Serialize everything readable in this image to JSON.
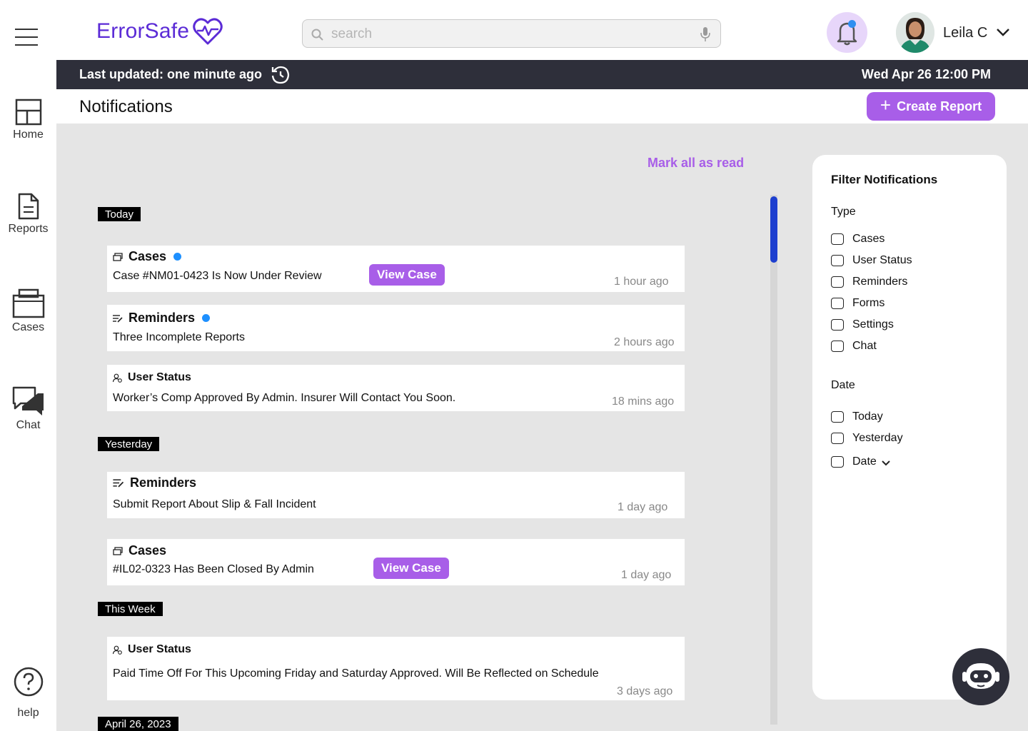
{
  "brand": {
    "name": "ErrorSafe",
    "accent": "#a85ee8",
    "logo_color": "#5b2bd6"
  },
  "rail": {
    "items": [
      {
        "label": "Home",
        "icon": "home-layout-icon"
      },
      {
        "label": "Reports",
        "icon": "document-icon"
      },
      {
        "label": "Cases",
        "icon": "briefcase-icon"
      },
      {
        "label": "Chat",
        "icon": "chat-bubbles-icon"
      }
    ],
    "help_label": "help"
  },
  "header": {
    "search_placeholder": "search",
    "user_name": "Leila C",
    "notification_unread": true
  },
  "statusbar": {
    "updated": "Last updated: one minute ago",
    "datetime": "Wed Apr 26 12:00 PM"
  },
  "page": {
    "title": "Notifications",
    "create_label": "Create Report",
    "mark_all_read": "Mark all as read"
  },
  "sections": {
    "today": "Today",
    "yesterday": "Yesterday",
    "this_week": "This Week",
    "april": "April 26, 2023"
  },
  "notifications": [
    {
      "type": "Cases",
      "icon": "cases-icon",
      "message": "Case #NM01-0423 Is Now Under Review",
      "time": "1 hour ago",
      "unread": true,
      "action": "View Case"
    },
    {
      "type": "Reminders",
      "icon": "reminder-icon",
      "message": "Three Incomplete Reports",
      "time": "2 hours ago",
      "unread": true
    },
    {
      "type": "User Status",
      "icon": "user-status-icon",
      "message": "Worker’s Comp Approved By Admin. Insurer Will Contact You Soon.",
      "time": "18 mins ago",
      "unread": false
    },
    {
      "type": "Reminders",
      "icon": "reminder-icon",
      "message": "Submit Report About Slip & Fall Incident",
      "time": "1 day ago",
      "unread": false
    },
    {
      "type": "Cases",
      "icon": "cases-icon",
      "message": "#IL02-0323 Has Been Closed By Admin",
      "time": "1 day ago",
      "unread": false,
      "action": "View Case"
    },
    {
      "type": "User Status",
      "icon": "user-status-icon",
      "message": "Paid Time Off For This Upcoming Friday and Saturday Approved. Will Be Reflected on Schedule",
      "time": "3 days ago",
      "unread": false
    }
  ],
  "filter": {
    "title": "Filter Notifications",
    "type_label": "Type",
    "types": [
      "Cases",
      "User Status",
      "Reminders",
      "Forms",
      "Settings",
      "Chat"
    ],
    "date_label": "Date",
    "dates": [
      "Today",
      "Yesterday",
      "Date"
    ]
  }
}
